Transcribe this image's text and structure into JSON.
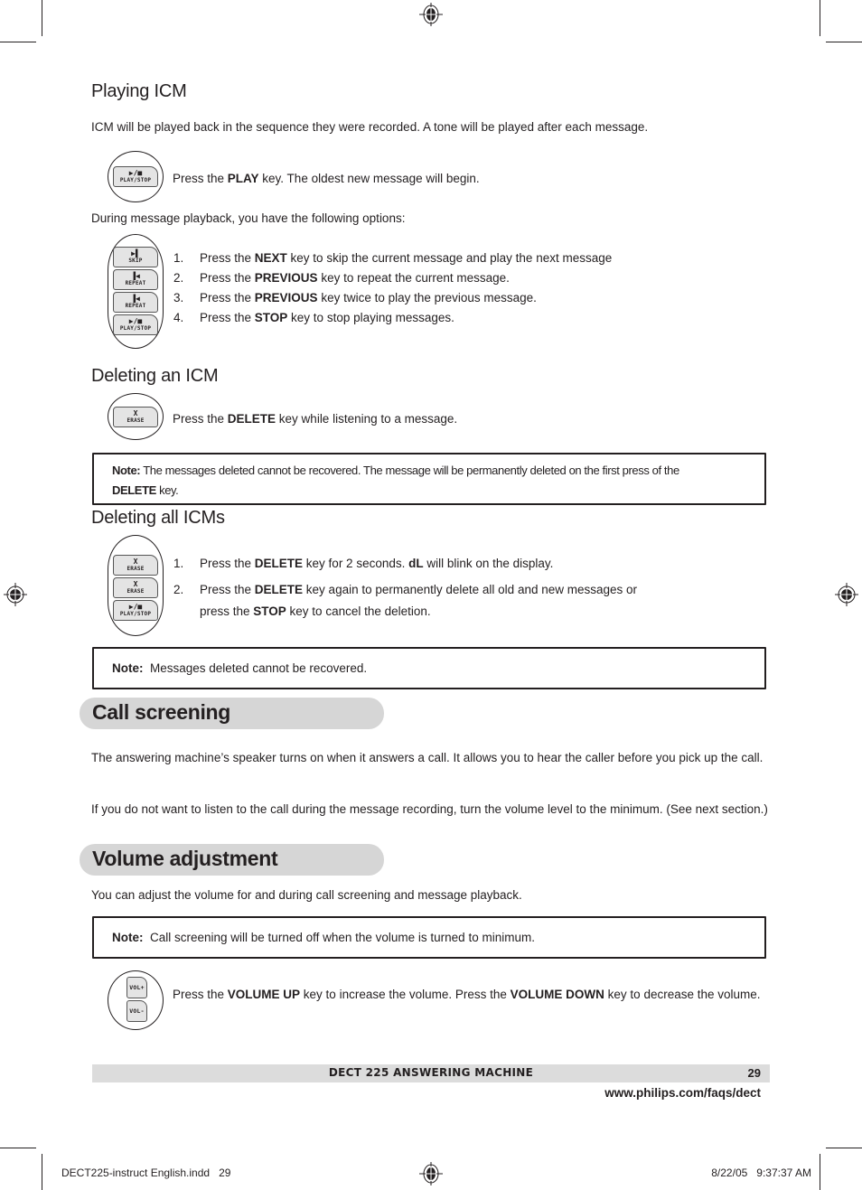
{
  "sections": {
    "playing": {
      "heading": "Playing ICM",
      "intro": "ICM will be played back in the sequence they were recorded.  A tone will be played after each message.",
      "play_instruction": {
        "pre": "Press the ",
        "key": "PLAY",
        "post": " key.  The oldest new message will begin."
      },
      "options_intro": "During message playback, you have the following options:",
      "options": [
        {
          "num": "1.",
          "pre": "Press the ",
          "key": "NEXT",
          "post": " key to skip the current message and play the next message"
        },
        {
          "num": "2.",
          "pre": "Press the ",
          "key": "PREVIOUS",
          "post": " key to repeat the current message."
        },
        {
          "num": "3.",
          "pre": "Press the ",
          "key": "PREVIOUS",
          "post": " key twice to play the previous message."
        },
        {
          "num": "4.",
          "pre": "Press the ",
          "key": "STOP",
          "post": " key to stop playing messages."
        }
      ]
    },
    "delete_one": {
      "heading": "Deleting an ICM",
      "instruction": {
        "pre": "Press the ",
        "key": "DELETE",
        "post": " key while listening to a message."
      },
      "note": {
        "label": "Note:",
        "text": " The messages deleted cannot be recovered. The message will be permanently deleted on the first press of the ",
        "key": "DELETE",
        "post": " key."
      }
    },
    "delete_all": {
      "heading": "Deleting all ICMs",
      "steps": [
        {
          "num": "1.",
          "pre": "Press the ",
          "key": "DELETE",
          "mid": " key for 2 seconds.  ",
          "key2": "dL",
          "post": " will blink on the display."
        },
        {
          "num": "2.",
          "pre": "Press the ",
          "key": "DELETE",
          "post": " key again to permanently delete all old and new messages or",
          "line2_pre": " press the ",
          "line2_key": "STOP",
          "line2_post": " key to cancel the deletion."
        }
      ],
      "note": {
        "label": "Note:",
        "text": "  Messages deleted cannot be recovered."
      }
    },
    "call_screening": {
      "heading": "Call screening",
      "para1": "The answering machine’s speaker turns on when it answers a call.  It allows you to hear the caller before you pick up the call.",
      "para2": "If you do not want to listen to the call during the message recording, turn the volume level to the minimum.  (See next section.)"
    },
    "volume": {
      "heading": "Volume adjustment",
      "intro": "You can adjust the volume for and during call screening and message playback.",
      "note": {
        "label": "Note:",
        "text": "  Call screening will be turned off when the volume is turned to minimum."
      },
      "instruction": {
        "pre": "Press the ",
        "key": "VOLUME UP",
        "mid": " key to increase the volume.  Press the ",
        "key2": "VOLUME DOWN",
        "post": " key to decrease the volume."
      }
    }
  },
  "keys": {
    "play_stop": {
      "glyph": "▶/■",
      "label": "PLAY/STOP"
    },
    "skip": {
      "glyph": "▶▌",
      "label": "SKIP"
    },
    "repeat": {
      "glyph": "▐◀",
      "label": "REPEAT"
    },
    "erase": {
      "glyph": "X",
      "label": "ERASE"
    },
    "vol_up": {
      "label": "VOL+"
    },
    "vol_down": {
      "label": "VOL-"
    }
  },
  "footer": {
    "title": "DECT 225 ANSWERING MACHINE",
    "page": "29",
    "url": "www.philips.com/faqs/dect"
  },
  "slug": {
    "file": "DECT225-instruct English.indd   29",
    "datetime": "8/22/05   9:37:37 AM"
  }
}
